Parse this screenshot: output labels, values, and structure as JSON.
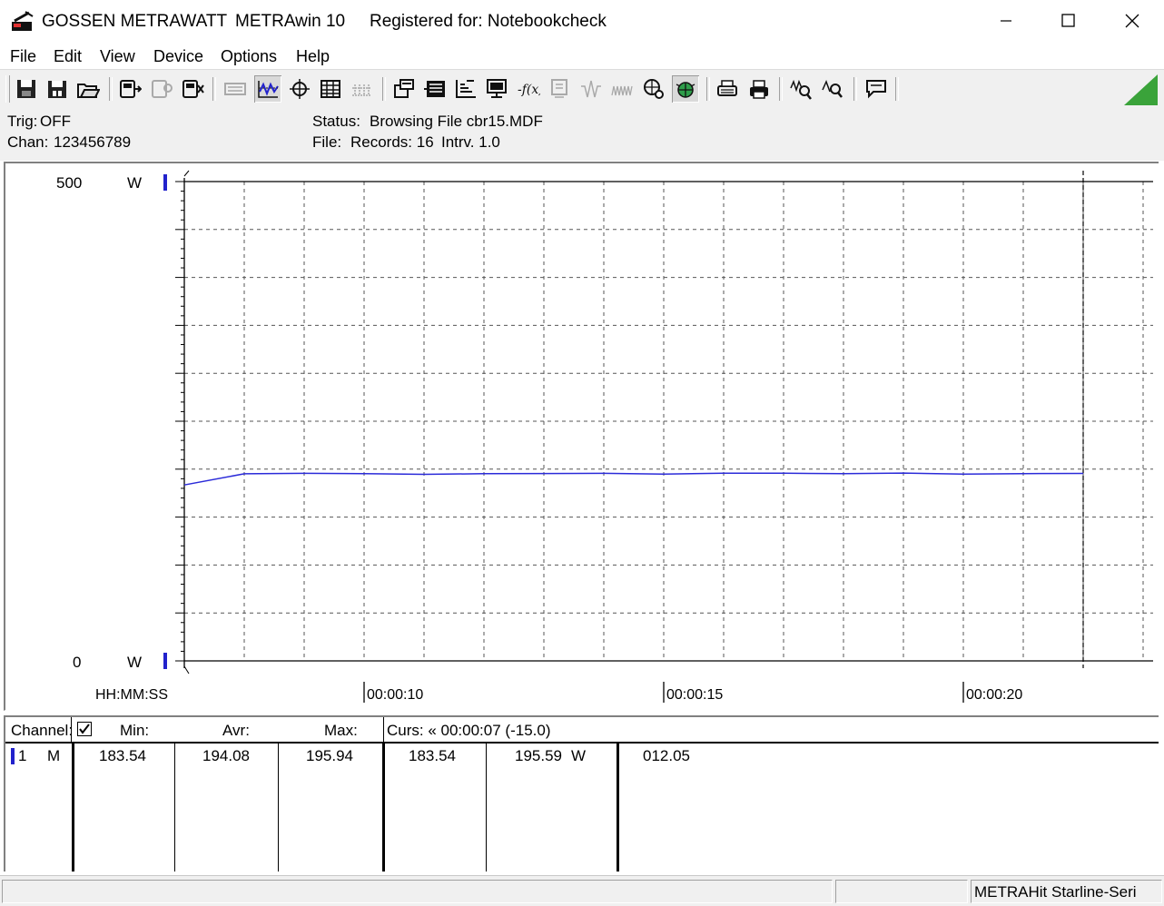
{
  "window": {
    "brand": "GOSSEN METRAWATT",
    "app_name": "METRAwin 10",
    "registration": "Registered for: Notebookcheck"
  },
  "menu": [
    "File",
    "Edit",
    "View",
    "Device",
    "Options",
    "Help"
  ],
  "toolbar_icons": [
    "save-data-icon",
    "save-config-icon",
    "open-file-icon",
    "device-read-icon",
    "device-settings-icon",
    "device-clear-icon",
    "keyboard-icon",
    "waveform-display-icon",
    "crosshair-cursor-icon",
    "table-view-icon",
    "grid-view-icon",
    "channel-setup-icon",
    "list-icon",
    "bar-chart-icon",
    "monitor-icon",
    "formula-icon",
    "memory-icon",
    "wave-icon",
    "noise-icon",
    "globe-icon",
    "bug-icon",
    "print-preview-icon",
    "print-icon",
    "zoom-wave-icon",
    "zoom-search-icon",
    "comment-icon"
  ],
  "info": {
    "trig_label": "Trig:",
    "trig_value": "OFF",
    "chan_label": "Chan:",
    "chan_value": "123456789",
    "status_label": "Status:",
    "status_value": "Browsing File cbr15.MDF",
    "file_label": "File:",
    "records_text": "Records: 16",
    "interval_text": "Intrv. 1.0"
  },
  "chart_data": {
    "type": "line",
    "y_top": "500",
    "y_bottom": "0",
    "y_unit": "W",
    "ylim": [
      0,
      500
    ],
    "x_axis_label": "HH:MM:SS",
    "x_tick_labels": [
      "00:00:10",
      "00:00:15",
      "00:00:20"
    ],
    "x_ticks": [
      10,
      15,
      20
    ],
    "xlim": [
      7,
      22
    ],
    "cursor_time": 22,
    "grid": true,
    "series": [
      {
        "color": "#2b2bd9",
        "x": [
          7,
          8,
          9,
          10,
          11,
          12,
          13,
          14,
          15,
          16,
          17,
          18,
          19,
          20,
          21,
          22
        ],
        "y": [
          183.54,
          195.2,
          195.6,
          195.4,
          194.6,
          195.3,
          195.5,
          195.6,
          194.9,
          195.8,
          195.7,
          195.3,
          195.9,
          194.9,
          195.4,
          195.59
        ]
      }
    ]
  },
  "table": {
    "headers": {
      "channel": "Channel:",
      "min": "Min:",
      "avr": "Avr:",
      "max": "Max:",
      "cursor": "Curs: « 00:00:07 (-15.0)"
    },
    "rows": [
      {
        "channel": "1",
        "mode": "M",
        "min": "183.54",
        "avr": "194.08",
        "max": "195.94",
        "curs1": "183.54",
        "curs2": "195.59",
        "unit": "W",
        "delta": "012.05"
      }
    ]
  },
  "statusbar": {
    "device": "METRAHit Starline-Seri"
  }
}
